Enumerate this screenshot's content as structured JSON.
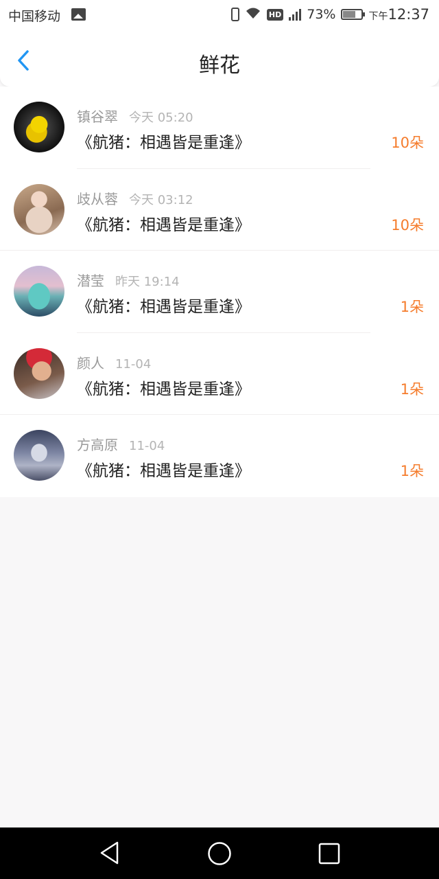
{
  "status_bar": {
    "carrier": "中国移动",
    "network": "4G",
    "hd": "HD",
    "battery": "73%",
    "period": "下午",
    "time": "12:37"
  },
  "header": {
    "title": "鲜花"
  },
  "items": [
    {
      "name": "镇谷翠",
      "time": "今天 05:20",
      "title": "《航猪：相遇皆是重逢》",
      "count": "10朵"
    },
    {
      "name": "歧从蓉",
      "time": "今天 03:12",
      "title": "《航猪：相遇皆是重逢》",
      "count": "10朵"
    },
    {
      "name": "潜莹",
      "time": "昨天 19:14",
      "title": "《航猪：相遇皆是重逢》",
      "count": "1朵"
    },
    {
      "name": "颜人",
      "time": "11-04",
      "title": "《航猪：相遇皆是重逢》",
      "count": "1朵"
    },
    {
      "name": "方高原",
      "time": "11-04",
      "title": "《航猪：相遇皆是重逢》",
      "count": "1朵"
    }
  ],
  "colors": {
    "accent_blue": "#2196f3",
    "count_orange": "#f57c2c",
    "background": "#f8f7f8"
  }
}
